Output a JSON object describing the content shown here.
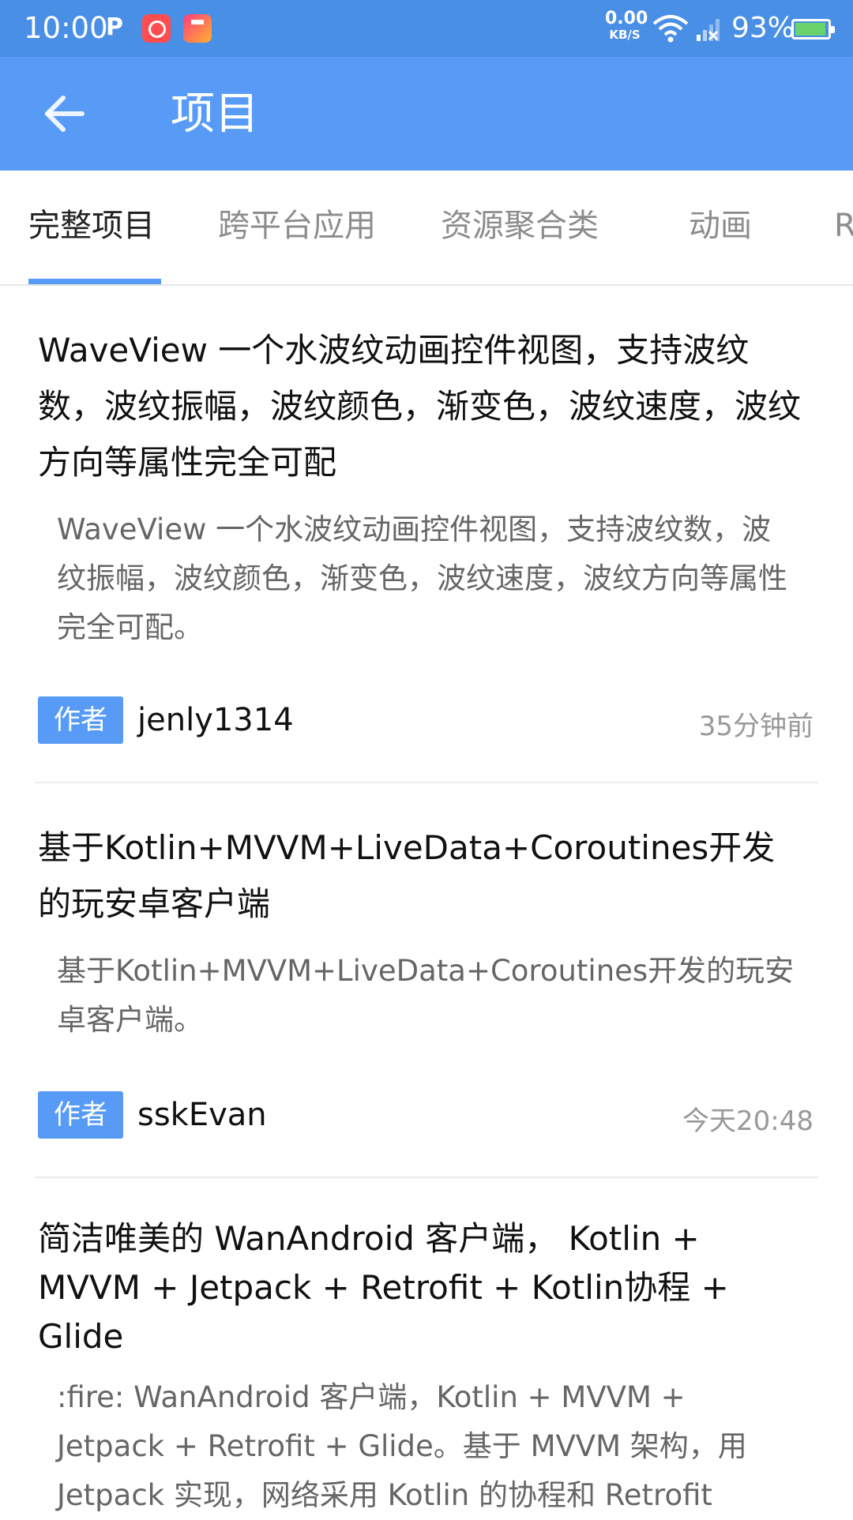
{
  "status_bar": {
    "time": "10:00",
    "net_speed_value": "0.00",
    "net_speed_unit": "KB/S",
    "battery_percent": "93%",
    "icons": [
      "parking-icon",
      "app-notification-icon",
      "app-notification-icon",
      "wifi-icon",
      "signal-icon",
      "battery-icon"
    ]
  },
  "app_bar": {
    "title": "项目",
    "back_icon": "arrow-left-icon"
  },
  "tabs": [
    {
      "label": "完整项目",
      "active": true
    },
    {
      "label": "跨平台应用",
      "active": false
    },
    {
      "label": "资源聚合类",
      "active": false
    },
    {
      "label": "动画",
      "active": false
    },
    {
      "label": "R",
      "active": false
    }
  ],
  "articles": [
    {
      "title": "WaveView 一个水波纹动画控件视图，支持波纹数，波纹振幅，波纹颜色，渐变色，波纹速度，波纹方向等属性完全可配",
      "desc": "WaveView 一个水波纹动画控件视图，支持波纹数，波纹振幅，波纹颜色，渐变色，波纹速度，波纹方向等属性完全可配。",
      "tag": "作者",
      "author": "jenly1314",
      "time": "35分钟前"
    },
    {
      "title": "基于Kotlin+MVVM+LiveData+Coroutines开发的玩安卓客户端",
      "desc": "基于Kotlin+MVVM+LiveData+Coroutines开发的玩安卓客户端。",
      "tag": "作者",
      "author": "sskEvan",
      "time": "今天20:48"
    },
    {
      "title": "简洁唯美的 WanAndroid 客户端， Kotlin + MVVM + Jetpack + Retrofit + Kotlin协程 + Glide",
      "desc": ":fire: WanAndroid 客户端，Kotlin + MVVM + Jetpack + Retrofit + Glide。基于 MVVM 架构，用 Jetpack 实现，网络采用 Kotlin 的协程和 Retrofit"
    }
  ],
  "colors": {
    "status_bar": "#4a8fe6",
    "primary": "#579bf7",
    "title_text": "#111111",
    "desc_text": "#666666",
    "meta_text": "#999999"
  }
}
